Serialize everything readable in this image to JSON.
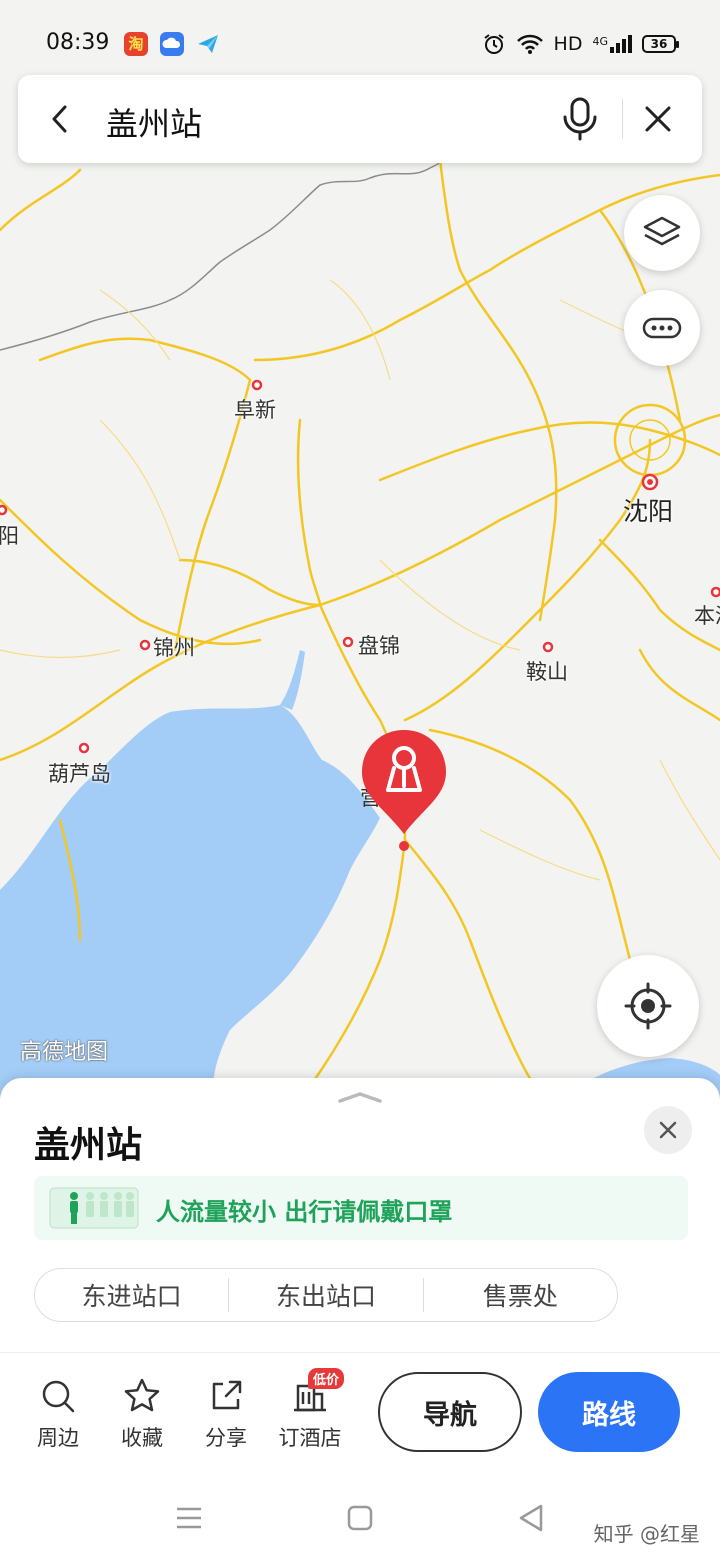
{
  "status_bar": {
    "time": "08:39",
    "hd": "HD",
    "net": "4G",
    "battery": "36",
    "icons": [
      "taobao-icon",
      "cloud-icon",
      "paper-plane-icon",
      "alarm-icon",
      "wifi-icon",
      "signal-icon",
      "battery-icon"
    ]
  },
  "search": {
    "query": "盖州站",
    "icons": [
      "back-icon",
      "mic-icon",
      "close-icon"
    ]
  },
  "map": {
    "watermark": "高德地图",
    "labels": {
      "fuxin": "阜新",
      "shenyang": "沈阳",
      "jinzhou": "锦州",
      "panjin": "盘锦",
      "anshan": "鞍山",
      "huludao": "葫芦岛",
      "left_edge": "阳",
      "right_edge": "本溪"
    },
    "colors": {
      "road": "#f3c624",
      "water": "#a3cdf7",
      "land": "#f3f4f1",
      "marker": "#e8343b"
    }
  },
  "sheet": {
    "title": "盖州站",
    "crowd_notice": "人流量较小 出行请佩戴口罩",
    "entrances": [
      "东进站口",
      "东出站口",
      "售票处"
    ],
    "actions": [
      {
        "label": "周边",
        "icon": "search-icon"
      },
      {
        "label": "收藏",
        "icon": "star-icon"
      },
      {
        "label": "分享",
        "icon": "share-icon"
      },
      {
        "label": "订酒店",
        "icon": "hotel-icon",
        "badge": "低价"
      }
    ],
    "navigate": "导航",
    "route": "路线"
  },
  "footer": {
    "credit": "知乎 @红星"
  },
  "colors": {
    "primary": "#2b74f6",
    "green": "#1fa25a"
  }
}
